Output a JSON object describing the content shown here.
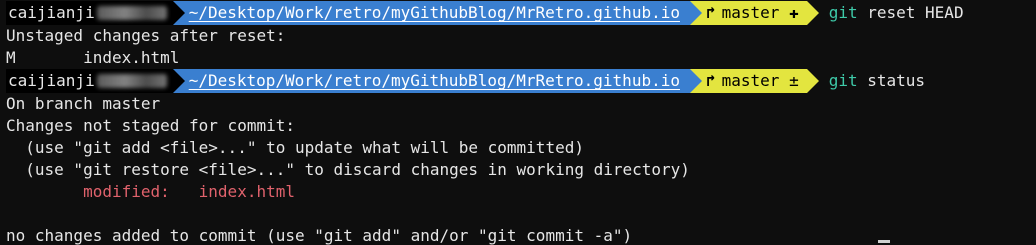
{
  "prompt1": {
    "user": "caijianji",
    "path": "~/Desktop/Work/retro/myGithubBlog/MrRetro.github.io",
    "branch_icon": "branch-icon",
    "branch": "master",
    "status_mark": "✚",
    "cmd": "git",
    "args": " reset HEAD"
  },
  "output1": [
    "Unstaged changes after reset:",
    "M       index.html"
  ],
  "prompt2": {
    "user": "caijianji",
    "path": "~/Desktop/Work/retro/myGithubBlog/MrRetro.github.io",
    "branch_icon": "branch-icon",
    "branch": "master",
    "status_mark": "±",
    "cmd": "git",
    "args": " status"
  },
  "output2": {
    "l1": "On branch master",
    "l2": "Changes not staged for commit:",
    "l3": "  (use \"git add <file>...\" to update what will be committed)",
    "l4": "  (use \"git restore <file>...\" to discard changes in working directory)",
    "modified_indent": "        ",
    "modified_label": "modified:   ",
    "modified_file": "index.html",
    "blank": " ",
    "l7": "no changes added to commit (use \"git add\" and/or \"git commit -a\")"
  },
  "colors": {
    "background": "#0e0e0e",
    "user_segment": "#000000",
    "path_segment": "#3a7fd0",
    "git_segment": "#e3e53f",
    "command": "#3ec9a8",
    "modified": "#e0626c"
  }
}
